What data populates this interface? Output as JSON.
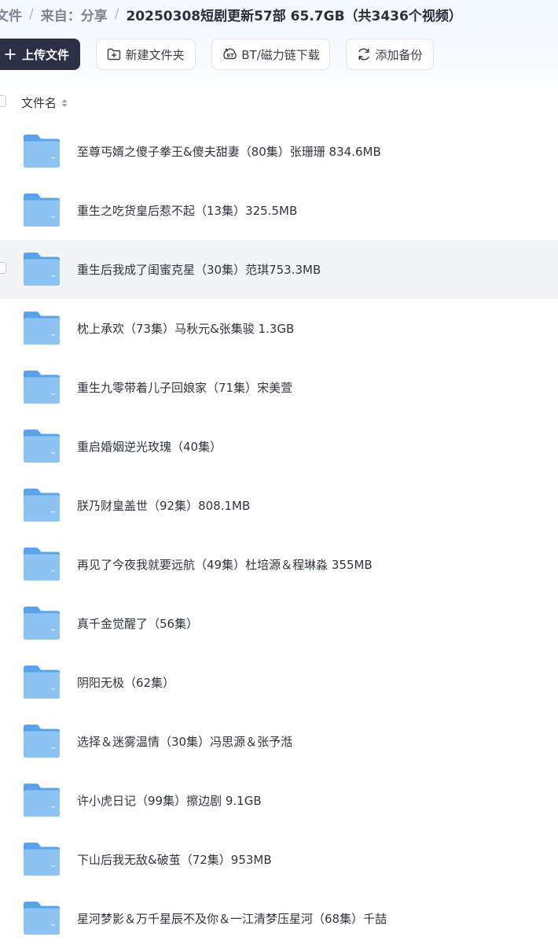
{
  "breadcrumb": {
    "root": "文件",
    "parent": "来自：分享",
    "current": "20250308短剧更新57部 65.7GB（共3436个视频）",
    "separator": "/"
  },
  "toolbar": {
    "upload_label": "上传文件",
    "new_folder_label": "新建文件夹",
    "bt_label": "BT/磁力链下载",
    "backup_label": "添加备份"
  },
  "list": {
    "column_name": "文件名",
    "rows": [
      {
        "name": "至尊丐婿之傻子拳王&傻夫甜妻（80集）张珊珊 834.6MB"
      },
      {
        "name": "重生之吃货皇后惹不起（13集）325.5MB"
      },
      {
        "name": "重生后我成了闺蜜克星（30集）范琪753.3MB"
      },
      {
        "name": "枕上承欢（73集）马秋元&张集骏 1.3GB"
      },
      {
        "name": "重生九零带着儿子回娘家（71集）宋美萱"
      },
      {
        "name": "重启婚姻逆光玫瑰（40集）"
      },
      {
        "name": "朕乃财皇盖世（92集）808.1MB"
      },
      {
        "name": "再见了今夜我就要远航（49集）杜培源＆程琳淼 355MB"
      },
      {
        "name": "真千金觉醒了（56集）"
      },
      {
        "name": "阴阳无极（62集）"
      },
      {
        "name": "选择＆迷雾温情（30集）冯思源＆张予湉"
      },
      {
        "name": "许小虎日记（99集）擦边剧 9.1GB"
      },
      {
        "name": "下山后我无敌&破茧（72集）953MB"
      },
      {
        "name": "星河梦影＆万千星辰不及你＆一江清梦压星河（68集）千喆"
      }
    ]
  },
  "colors": {
    "primary_button": "#2b3044",
    "folder_body": "#8ec4f4",
    "folder_tab": "#5aa3ea",
    "hover_row": "#f3f4f6"
  }
}
